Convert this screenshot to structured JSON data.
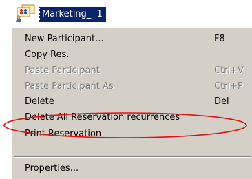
{
  "tree_node": {
    "icon": "participant-group-icon",
    "label": "Marketing_  1"
  },
  "context_menu": {
    "items": [
      {
        "label": "New Participant...",
        "shortcut": "F8",
        "enabled": true
      },
      {
        "label": "Copy Res.",
        "shortcut": "",
        "enabled": true
      },
      {
        "label": "Paste Participant",
        "shortcut": "Ctrl+V",
        "enabled": false
      },
      {
        "label": "Paste Participant As",
        "shortcut": "Ctrl+P",
        "enabled": false
      },
      {
        "label": "Delete",
        "shortcut": "Del",
        "enabled": true
      },
      {
        "label": "Delete All Reservation recurrences",
        "shortcut": "",
        "enabled": true
      },
      {
        "label": "Print Reservation",
        "shortcut": "",
        "enabled": true
      },
      {
        "label": "Properties...",
        "shortcut": "",
        "enabled": true
      }
    ]
  },
  "annotation": {
    "shape": "ellipse",
    "color": "#e01010",
    "highlights": "Delete All Reservation recurrences"
  },
  "colors": {
    "menu_background": "#d4d0c8",
    "selection_background": "#0a246a",
    "disabled_text": "#808080"
  }
}
